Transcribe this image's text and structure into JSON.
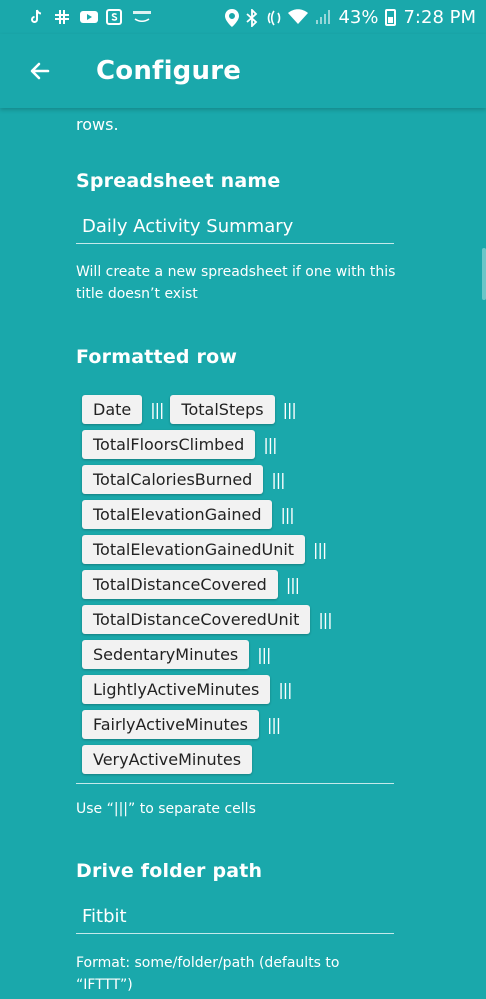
{
  "status_bar": {
    "battery": "43%",
    "time": "7:28 PM",
    "battery_level": 0.43
  },
  "app_bar": {
    "title": "Configure"
  },
  "description_tail": "rows.",
  "spreadsheet_name": {
    "label": "Spreadsheet name",
    "value": "Daily Activity Summary",
    "helper": "Will create a new spreadsheet if one with this title doesn’t exist"
  },
  "formatted_row": {
    "label": "Formatted row",
    "separator": "|||",
    "tokens": [
      "Date",
      "TotalSteps",
      "TotalFloorsClimbed",
      "TotalCaloriesBurned",
      "TotalElevationGained",
      "TotalElevationGainedUnit",
      "TotalDistanceCovered",
      "TotalDistanceCoveredUnit",
      "SedentaryMinutes",
      "LightlyActiveMinutes",
      "FairlyActiveMinutes",
      "VeryActiveMinutes"
    ],
    "helper": "Use “|||” to separate cells"
  },
  "drive_folder": {
    "label": "Drive folder path",
    "value": "Fitbit",
    "helper": "Format: some/folder/path (defaults to “IFTTT”)"
  },
  "icons": {
    "back": "arrow-left-icon",
    "tiktok": "tiktok-icon",
    "slack": "slack-icon",
    "youtube": "youtube-icon",
    "samsung_pay": "samsung-pay-icon",
    "amazon": "amazon-icon",
    "location": "location-icon",
    "bluetooth": "bluetooth-icon",
    "nfc": "nfc-icon",
    "wifi": "wifi-icon",
    "signal": "signal-icon",
    "battery": "battery-icon"
  },
  "colors": {
    "background": "#1aa8ab",
    "chip": "#f2f2f2",
    "text": "#ffffff"
  }
}
